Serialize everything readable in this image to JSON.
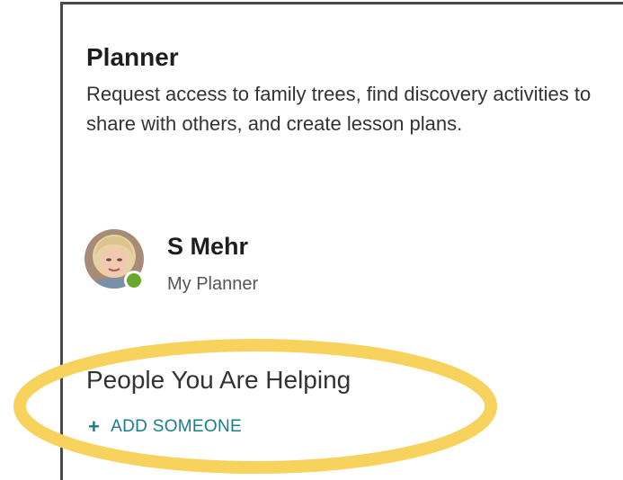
{
  "panel": {
    "title": "Planner",
    "description": "Request access to family trees, find discovery activities to share with others, and create lesson plans."
  },
  "profile": {
    "name": "S Mehr",
    "subtitle": "My Planner",
    "status_color": "#6aa72d"
  },
  "helping": {
    "heading": "People You Are Helping",
    "add_icon": "plus-icon",
    "add_label": "ADD SOMEONE",
    "link_color": "#1b7b8c"
  },
  "annotation": {
    "highlight_color": "#f7d25c"
  }
}
